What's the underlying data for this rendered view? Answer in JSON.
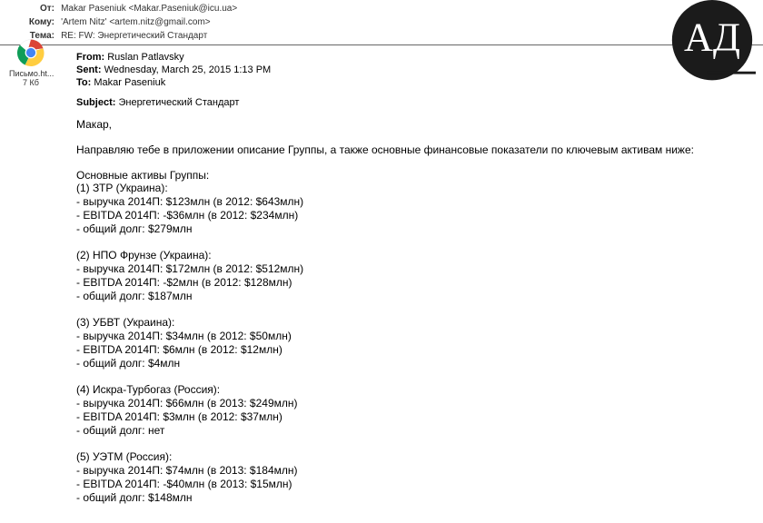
{
  "outer": {
    "from_label": "От:",
    "from_value": "Makar Paseniuk <Makar.Paseniuk@icu.ua>",
    "to_label": "Кому:",
    "to_value": "'Artem Nitz' <artem.nitz@gmail.com>",
    "subj_label": "Тема:",
    "subj_value": "RE: FW: Энергетический Стандарт"
  },
  "attachment": {
    "name": "Письмо.ht...",
    "size": "7 Кб"
  },
  "inner": {
    "from_label": "From:",
    "from_value": "Ruslan Patlavsky",
    "sent_label": "Sent:",
    "sent_value": "Wednesday, March 25, 2015 1:13 PM",
    "to_label": "To:",
    "to_value": "Makar Paseniuk",
    "subj_label": "Subject:",
    "subj_value": "Энергетический Стандарт"
  },
  "body": {
    "greeting": "Макар,",
    "intro": "Направляю тебе в приложении описание Группы, а также основные финансовые показатели по ключевым активам ниже:",
    "assets_title": "Основные активы Группы:",
    "assets": [
      {
        "head": "(1) ЗТР (Украина):",
        "rev": "- выручка 2014П: $123млн (в 2012: $643млн)",
        "ebitda": "- EBITDA 2014П: -$36млн (в 2012: $234млн)",
        "debt": "- общий долг: $279млн"
      },
      {
        "head": "(2) НПО Фрунзе (Украина):",
        "rev": "- выручка 2014П: $172млн (в 2012: $512млн)",
        "ebitda": "- EBITDA 2014П: -$2млн (в 2012: $128млн)",
        "debt": "- общий долг: $187млн"
      },
      {
        "head": "(3) УБВТ (Украина):",
        "rev": "- выручка 2014П: $34млн (в 2012: $50млн)",
        "ebitda": "- EBITDA 2014П: $6млн (в 2012: $12млн)",
        "debt": "- общий долг: $4млн"
      },
      {
        "head": "(4) Искра-Турбогаз (Россия):",
        "rev": "- выручка 2014П: $66млн (в 2013: $249млн)",
        "ebitda": "- EBITDA 2014П: $3млн (в 2012: $37млн)",
        "debt": "- общий долг: нет"
      },
      {
        "head": "(5) УЭТМ (Россия):",
        "rev": "- выручка 2014П: $74млн (в 2013: $184млн)",
        "ebitda": "- EBITDA 2014П: -$40млн (в 2013: $15млн)",
        "debt": "- общий долг: $148млн"
      }
    ]
  },
  "logo_text": "АД"
}
